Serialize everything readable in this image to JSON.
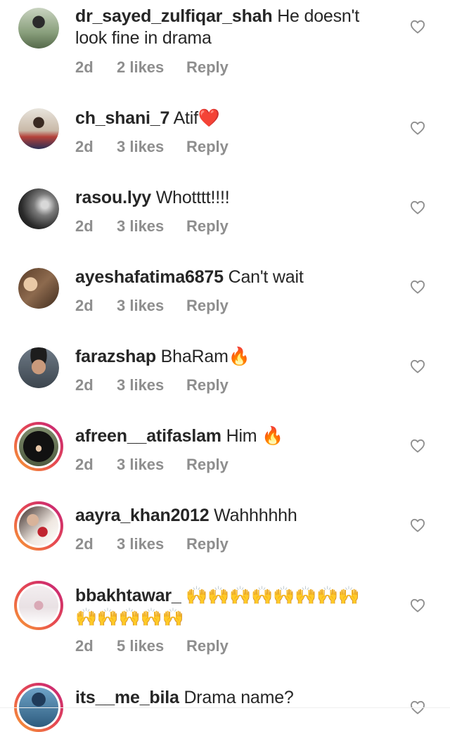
{
  "comments": [
    {
      "username": "dr_sayed_zulfiqar_shah",
      "text": "He doesn't look fine in drama",
      "time": "2d",
      "likes": "2 likes",
      "reply": "Reply",
      "avatar": "avatar-photo"
    },
    {
      "username": "ch_shani_7",
      "text": "Atif❤️",
      "time": "2d",
      "likes": "3 likes",
      "reply": "Reply",
      "avatar": "avatar-photo"
    },
    {
      "username": "rasou.lyy",
      "text": "Whotttt!!!!",
      "time": "2d",
      "likes": "3 likes",
      "reply": "Reply",
      "avatar": "avatar-photo"
    },
    {
      "username": "ayeshafatima6875",
      "text": "Can't wait",
      "time": "2d",
      "likes": "3 likes",
      "reply": "Reply",
      "avatar": "avatar-photo"
    },
    {
      "username": "farazshap",
      "text": "BhaRam🔥",
      "time": "2d",
      "likes": "3 likes",
      "reply": "Reply",
      "avatar": "avatar-photo"
    },
    {
      "username": "afreen__atifaslam",
      "text": "Him 🔥",
      "time": "2d",
      "likes": "3 likes",
      "reply": "Reply",
      "avatar": "story-ring-avatar"
    },
    {
      "username": "aayra_khan2012",
      "text": "Wahhhhhh",
      "time": "2d",
      "likes": "3 likes",
      "reply": "Reply",
      "avatar": "story-ring-avatar"
    },
    {
      "username": "bbakhtawar_",
      "text": "🙌🙌🙌🙌🙌🙌🙌🙌🙌🙌🙌🙌🙌",
      "time": "2d",
      "likes": "5 likes",
      "reply": "Reply",
      "avatar": "story-ring-avatar"
    },
    {
      "username": "its__me_bila",
      "text": "Drama name?",
      "avatar": "story-ring-avatar"
    }
  ],
  "icons": {
    "like": "heart-outline-icon"
  },
  "colors": {
    "text": "#262626",
    "secondary": "#8e8e8e",
    "ring_start": "#f7a234",
    "ring_end": "#c3207b"
  }
}
